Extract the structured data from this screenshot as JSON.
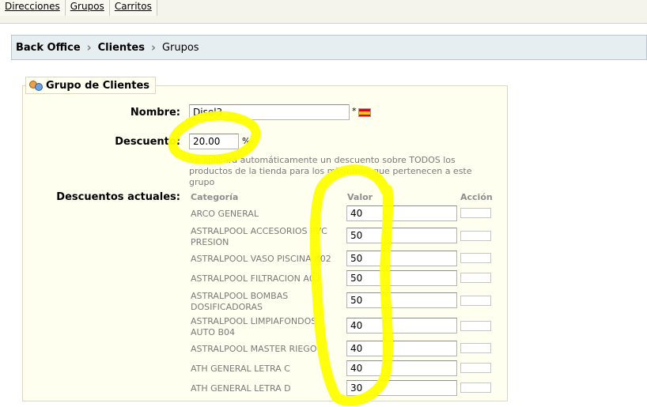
{
  "top_tabs": [
    "Direcciones",
    "Grupos",
    "Carritos"
  ],
  "breadcrumb": {
    "item1": "Back Office",
    "item2": "Clientes",
    "item3": "Grupos",
    "separator": "›"
  },
  "legend": {
    "title": "Grupo de Clientes",
    "icon": "users-group-icon"
  },
  "form": {
    "nombre_label": "Nombre:",
    "nombre_value": "Disel3",
    "required_mark": "*",
    "flag_icon": "spain-flag-icon",
    "descuento_label": "Descuento:",
    "descuento_value": "20.00",
    "percent_sign": "%",
    "hint": "Se aplicará automáticamente un descuento sobre TODOS los productos de la tienda para los miembros que pertenecen a este grupo",
    "descuentos_label": "Descuentos actuales:"
  },
  "table": {
    "headers": {
      "categoria": "Categoría",
      "valor": "Valor",
      "accion": "Acción"
    },
    "rows": [
      {
        "categoria": "ARCO GENERAL",
        "valor": "40"
      },
      {
        "categoria": "ASTRALPOOL ACCESORIOS PVC PRESION",
        "valor": "50"
      },
      {
        "categoria": "ASTRALPOOL VASO PISCINA A02",
        "valor": "50"
      },
      {
        "categoria": "ASTRALPOOL FILTRACION A03",
        "valor": "50"
      },
      {
        "categoria": "ASTRALPOOL BOMBAS DOSIFICADORAS",
        "valor": "50"
      },
      {
        "categoria": "ASTRALPOOL LIMPIAFONDOS AUTO B04",
        "valor": "40"
      },
      {
        "categoria": "ASTRALPOOL MASTER RIEGO",
        "valor": "40"
      },
      {
        "categoria": "ATH GENERAL LETRA C",
        "valor": "40"
      },
      {
        "categoria": "ATH GENERAL LETRA D",
        "valor": "30"
      }
    ]
  },
  "colors": {
    "highlight_marker": "#ffff00",
    "breadcrumb_bg": "#e7eef1",
    "form_bg": "#fffff0"
  }
}
